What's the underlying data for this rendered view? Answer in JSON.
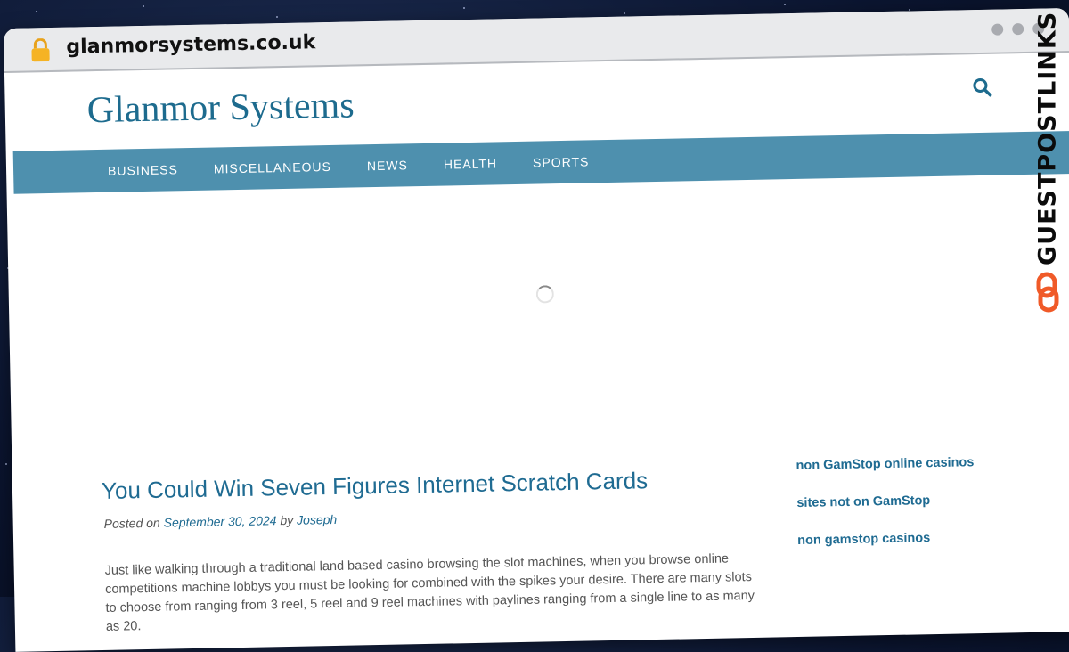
{
  "browser": {
    "url": "glanmorsystems.co.uk"
  },
  "site": {
    "title": "Glanmor Systems"
  },
  "nav": {
    "items": [
      {
        "label": "BUSINESS"
      },
      {
        "label": "MISCELLANEOUS"
      },
      {
        "label": "NEWS"
      },
      {
        "label": "HEALTH"
      },
      {
        "label": "SPORTS"
      }
    ]
  },
  "post": {
    "title": "You Could Win Seven Figures Internet Scratch Cards",
    "posted_on_label": "Posted on",
    "date": "September 30, 2024",
    "by_label": "by",
    "author": "Joseph",
    "body": "Just like walking through a traditional land based casino browsing the slot machines, when you browse online competitions machine lobbys you must be looking for combined with the spikes your desire. There are many slots to choose from ranging from 3 reel, 5 reel and 9 reel machines with paylines ranging from a single line to as many as 20."
  },
  "sidebar": {
    "links": [
      {
        "label": "non GamStop online casinos"
      },
      {
        "label": "sites not on GamStop"
      },
      {
        "label": "non gamstop casinos"
      }
    ]
  },
  "watermark": {
    "text": "GUESTPOSTLINKS"
  },
  "colors": {
    "brand": "#1d6b8e",
    "nav_bg": "#4e90ae",
    "watermark_accent": "#f05a28"
  }
}
